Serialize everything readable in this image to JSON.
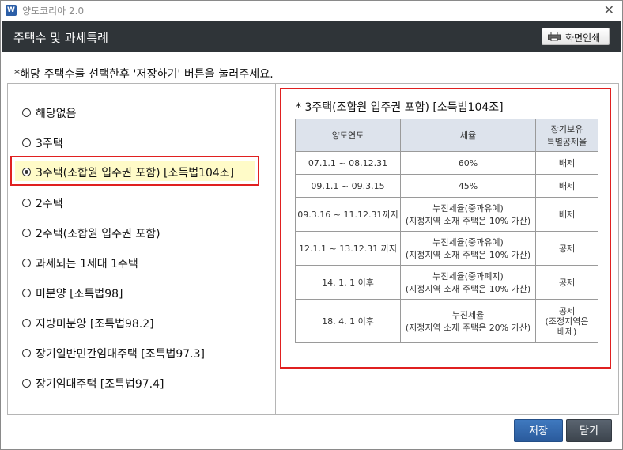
{
  "window": {
    "app_title": "양도코리아 2.0",
    "app_icon_glyph": "W",
    "close_glyph": "✕"
  },
  "header": {
    "title": "주택수 및 과세특례",
    "print_button": "화면인쇄"
  },
  "instruction": "*해당 주택수를 선택한후 '저장하기' 버튼을 눌러주세요.",
  "options": [
    {
      "label": "해당없음",
      "selected": false
    },
    {
      "label": "3주택",
      "selected": false
    },
    {
      "label": "3주택(조합원 입주권 포함) [소득법104조]",
      "selected": true
    },
    {
      "label": "2주택",
      "selected": false
    },
    {
      "label": "2주택(조합원 입주권 포함)",
      "selected": false
    },
    {
      "label": "과세되는 1세대 1주택",
      "selected": false
    },
    {
      "label": "미분양 [조특법98]",
      "selected": false
    },
    {
      "label": "지방미분양 [조특법98.2]",
      "selected": false
    },
    {
      "label": "장기일반민간임대주택 [조특법97.3]",
      "selected": false
    },
    {
      "label": "장기임대주택 [조특법97.4]",
      "selected": false
    }
  ],
  "detail": {
    "title": "* 3주택(조합원 입주권 포함) [소득법104조]",
    "columns": [
      "양도연도",
      "세율",
      "장기보유\n특별공제율"
    ],
    "rows": [
      {
        "period": "07.1.1 ~ 08.12.31",
        "rate": "60%",
        "deduction": "배제"
      },
      {
        "period": "09.1.1 ~ 09.3.15",
        "rate": "45%",
        "deduction": "배제"
      },
      {
        "period": "09.3.16 ~ 11.12.31까지",
        "rate": "누진세율(중과유예)\n(지정지역 소재 주택은 10% 가산)",
        "deduction": "배제"
      },
      {
        "period": "12.1.1 ~ 13.12.31 까지",
        "rate": "누진세율(중과유예)\n(지정지역 소재 주택은 10% 가산)",
        "deduction": "공제"
      },
      {
        "period": "14. 1. 1 이후",
        "rate": "누진세율(중과폐지)\n(지정지역 소재 주택은 10% 가산)",
        "deduction": "공제"
      },
      {
        "period": "18. 4. 1 이후",
        "rate": "누진세율\n(지정지역 소재 주택은 20% 가산)",
        "deduction": "공제\n(조정지역은\n배제)"
      }
    ]
  },
  "buttons": {
    "save": "저장",
    "close": "닫기"
  },
  "colors": {
    "header_bg": "#2f3438",
    "highlight_border": "#e02020",
    "selected_bg": "#fffbc8",
    "save_btn": "#3468ad",
    "close_btn": "#474f59",
    "table_header_bg": "#dde3ec"
  }
}
